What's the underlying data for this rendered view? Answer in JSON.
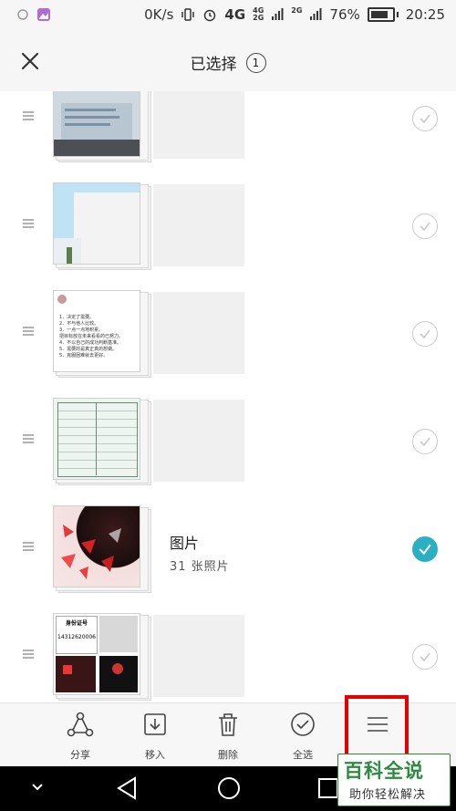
{
  "status": {
    "speed": "0K/s",
    "net1": "4G",
    "net2": "4G",
    "net3": "2G",
    "net4": "2G",
    "battery": "76%",
    "time": "20:25"
  },
  "header": {
    "title": "已选择",
    "count": "1"
  },
  "rows": [
    {
      "selected": false
    },
    {
      "selected": false
    },
    {
      "selected": false
    },
    {
      "selected": false
    },
    {
      "selected": true,
      "name": "图片",
      "count": "31 张照片"
    },
    {
      "selected": false
    }
  ],
  "thumb_texts": {
    "doc_lines": [
      "1．决定了需要。",
      "2．不与他人比较。",
      "3．一点一点地积累。",
      "把目标放在未来看看的已努力。",
      "4．不以自己的成功判断基准。",
      "5．需要的是真正真的想做。",
      "5．克服困难就去更好。"
    ],
    "card_label": "身份证号",
    "card_number": "14312620006"
  },
  "toolbar": [
    {
      "label": "分享",
      "icon": "share-icon"
    },
    {
      "label": "移入",
      "icon": "move-in-icon"
    },
    {
      "label": "删除",
      "icon": "trash-icon"
    },
    {
      "label": "全选",
      "icon": "check-circle-icon"
    },
    {
      "label": "",
      "icon": "menu-icon"
    }
  ],
  "watermark": {
    "title": "百科全说",
    "subtitle": "助你轻松解决"
  },
  "colors": {
    "accent": "#2ab0c2",
    "highlight": "#e60000",
    "watermark_green": "#2e8b3d"
  }
}
